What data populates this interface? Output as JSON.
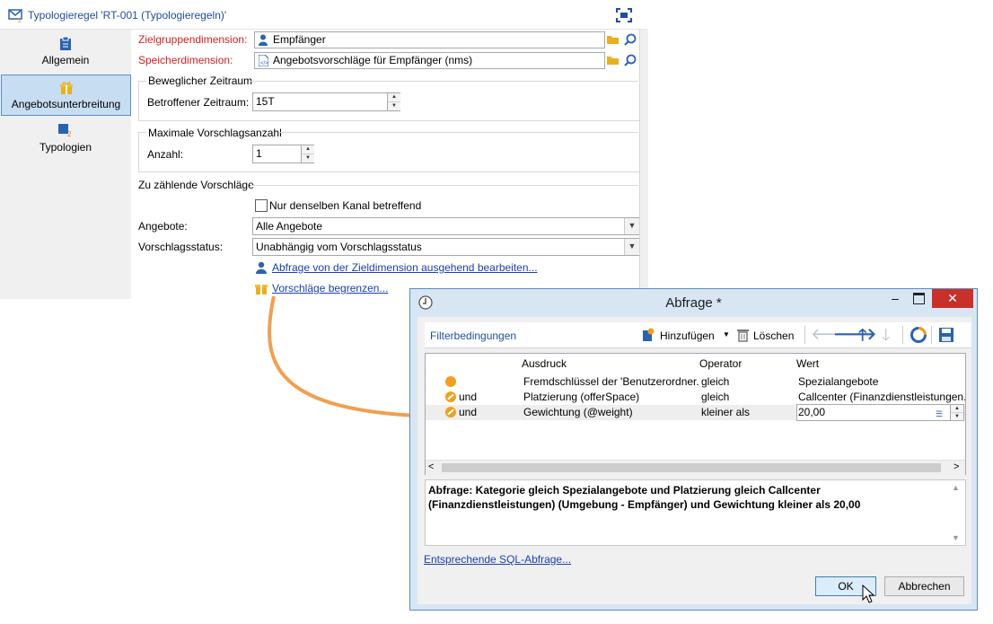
{
  "main_window": {
    "title": "Typologieregel 'RT-001 (Typologieregeln)'",
    "sidebar": {
      "items": [
        {
          "label": "Allgemein"
        },
        {
          "label": "Angebotsunterbreitung"
        },
        {
          "label": "Typologien"
        }
      ]
    },
    "form": {
      "target_dimension_label": "Zielgruppendimension:",
      "target_dimension_value": "Empfänger",
      "storage_dimension_label": "Speicherdimension:",
      "storage_dimension_value": "Angebotsvorschläge für Empfänger (nms)",
      "sliding_period_legend": "Beweglicher Zeitraum",
      "affected_period_label": "Betroffener Zeitraum:",
      "affected_period_value": "15T",
      "max_proposals_legend": "Maximale Vorschlagsanzahl",
      "count_label": "Anzahl:",
      "count_value": "1",
      "proposals_to_count_legend": "Zu zählende Vorschläge",
      "same_channel_label": "Nur denselben Kanal betreffend",
      "offers_label": "Angebote:",
      "offers_value": "Alle Angebote",
      "proposal_status_label": "Vorschlagsstatus:",
      "proposal_status_value": "Unabhängig vom Vorschlagsstatus",
      "edit_query_link": "Abfrage von der Zieldimension ausgehend bearbeiten...",
      "restrict_proposals_link": "Vorschläge begrenzen..."
    }
  },
  "dialog": {
    "title": "Abfrage *",
    "toolbar": {
      "section_label": "Filterbedingungen",
      "add_label": "Hinzufügen",
      "delete_label": "Löschen"
    },
    "grid": {
      "columns": [
        "Ausdruck",
        "Operator",
        "Wert"
      ],
      "rows": [
        {
          "conj": "",
          "expression": "Fremdschlüssel der 'Benutzerordner...",
          "operator": "gleich",
          "value": "Spezialangebote"
        },
        {
          "conj": "und",
          "expression": "Platzierung (offerSpace)",
          "operator": "gleich",
          "value": "Callcenter (Finanzdienstleistungen."
        },
        {
          "conj": "und",
          "expression": "Gewichtung (@weight)",
          "operator": "kleiner als",
          "value": "20,00"
        }
      ]
    },
    "query_text": "Abfrage: Kategorie gleich Spezialangebote und Platzierung gleich Callcenter (Finanzdienstleistungen) (Umgebung - Empfänger) und Gewichtung kleiner als 20,00",
    "sql_link": "Entsprechende SQL-Abfrage...",
    "ok_label": "OK",
    "cancel_label": "Abbrechen"
  },
  "colors": {
    "accent_blue": "#1f4e9b",
    "required_label_red": "#d42020",
    "link_blue": "#1a3fb0",
    "annotation_arrow_orange": "#f0a050",
    "close_button_red": "#c8312a"
  }
}
